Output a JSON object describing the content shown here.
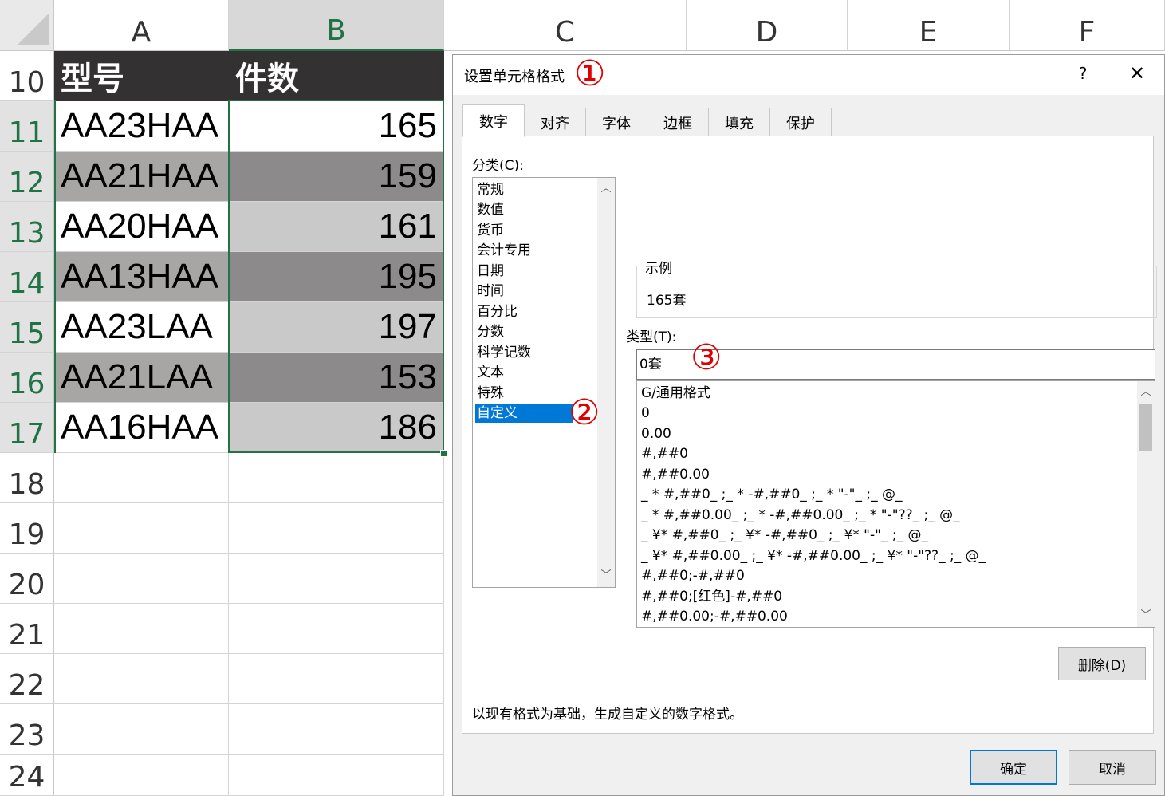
{
  "spreadsheet": {
    "columns": [
      "A",
      "B",
      "C",
      "D",
      "E",
      "F"
    ],
    "selected_column": "B",
    "rows": [
      "10",
      "11",
      "12",
      "13",
      "14",
      "15",
      "16",
      "17",
      "18",
      "19",
      "20",
      "21",
      "22",
      "23",
      "24"
    ],
    "header": {
      "col_a": "型号",
      "col_b": "件数"
    },
    "data": [
      {
        "model": "AA23HAA",
        "qty": "165"
      },
      {
        "model": "AA21HAA",
        "qty": "159"
      },
      {
        "model": "AA20HAA",
        "qty": "161"
      },
      {
        "model": "AA13HAA",
        "qty": "195"
      },
      {
        "model": "AA23LAA",
        "qty": "197"
      },
      {
        "model": "AA21LAA",
        "qty": "153"
      },
      {
        "model": "AA16HAA",
        "qty": "186"
      }
    ],
    "colors": {
      "header_fill": "#333131",
      "band_dark": "#8c8a8a",
      "band_light": "#c9c9c9",
      "model_dark": "#a8a5a5",
      "selection": "#217346"
    }
  },
  "dialog": {
    "title": "设置单元格格式",
    "badges": [
      "①",
      "②",
      "③"
    ],
    "help": "?",
    "close": "✕",
    "tabs": [
      "数字",
      "对齐",
      "字体",
      "边框",
      "填充",
      "保护"
    ],
    "active_tab": "数字",
    "category_label": "分类(C):",
    "categories": [
      "常规",
      "数值",
      "货币",
      "会计专用",
      "日期",
      "时间",
      "百分比",
      "分数",
      "科学记数",
      "文本",
      "特殊",
      "自定义"
    ],
    "selected_category": "自定义",
    "sample_label": "示例",
    "sample_value": "165套",
    "type_label": "类型(T):",
    "type_value": "0套",
    "format_list": [
      "G/通用格式",
      "0",
      "0.00",
      "#,##0",
      "#,##0.00",
      "_ * #,##0_ ;_ * -#,##0_ ;_ * \"-\"_ ;_ @_",
      "_ * #,##0.00_ ;_ * -#,##0.00_ ;_ * \"-\"??_ ;_ @_",
      "_ ¥* #,##0_ ;_ ¥* -#,##0_ ;_ ¥* \"-\"_ ;_ @_",
      "_ ¥* #,##0.00_ ;_ ¥* -#,##0.00_ ;_ ¥* \"-\"??_ ;_ @_",
      "#,##0;-#,##0",
      "#,##0;[红色]-#,##0",
      "#,##0.00;-#,##0.00"
    ],
    "delete_button": "删除(D)",
    "description": "以现有格式为基础，生成自定义的数字格式。",
    "ok_button": "确定",
    "cancel_button": "取消"
  }
}
